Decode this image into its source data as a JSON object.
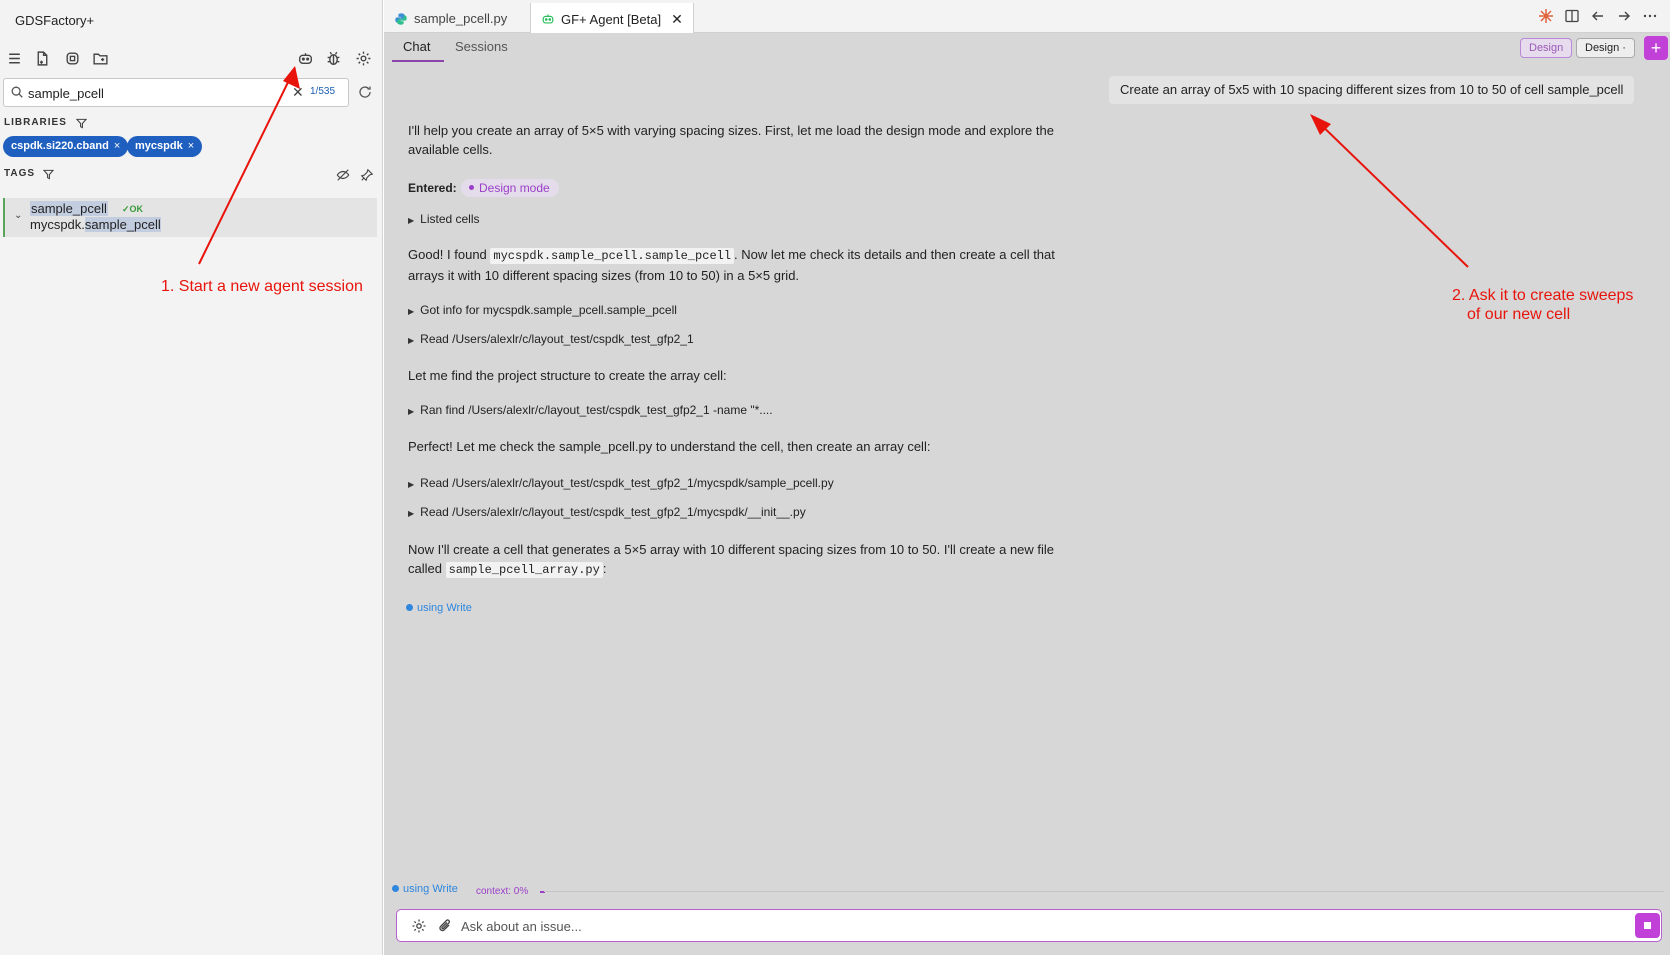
{
  "sidebar": {
    "app_title": "GDSFactory+",
    "search": {
      "value": "sample_pcell",
      "count": "1/535"
    },
    "libraries_label": "LIBRARIES",
    "libraries": [
      {
        "label": "cspdk.si220.cband",
        "remove": "×"
      },
      {
        "label": "mycspdk",
        "remove": "×"
      }
    ],
    "tags_label": "TAGS",
    "tree": {
      "chevron": "⌄",
      "name": "sample_pcell",
      "status": "✓OK",
      "path_prefix": "mycspdk.",
      "path_highlight": "sample_pcell"
    }
  },
  "tabs": [
    {
      "label": "sample_pcell.py",
      "icon": "python-icon",
      "active": false
    },
    {
      "label": "GF+ Agent [Beta]",
      "icon": "agent-icon",
      "active": true,
      "close": "✕"
    }
  ],
  "chat": {
    "tabs": [
      "Chat",
      "Sessions"
    ],
    "mode_badge": "Design",
    "mode_select": "Design ·",
    "plus": "+",
    "user_message": "Create an array of 5x5 with 10 spacing different sizes from 10 to 50 of cell sample_pcell",
    "assistant": {
      "msg1": "I'll help you create an array of 5×5 with varying spacing sizes. First, let me load the design mode and explore the available cells.",
      "entered_label": "Entered:",
      "entered_mode": "Design mode",
      "tool1": "Listed cells",
      "msg2_a": "Good! I found ",
      "msg2_code": "mycspdk.sample_pcell.sample_pcell",
      "msg2_b": ". Now let me check its details and then create a cell that arrays it with 10 different spacing sizes (from 10 to 50) in a 5×5 grid.",
      "tool2": "Got info for mycspdk.sample_pcell.sample_pcell",
      "tool3": "Read /Users/alexlr/c/layout_test/cspdk_test_gfp2_1",
      "msg3": "Let me find the project structure to create the array cell:",
      "tool4": "Ran find /Users/alexlr/c/layout_test/cspdk_test_gfp2_1 -name \"*....",
      "msg4": "Perfect! Let me check the sample_pcell.py to understand the cell, then create an array cell:",
      "tool5": "Read /Users/alexlr/c/layout_test/cspdk_test_gfp2_1/mycspdk/sample_pcell.py",
      "tool6": "Read /Users/alexlr/c/layout_test/cspdk_test_gfp2_1/mycspdk/__init__.py",
      "msg5_a": "Now I'll create a cell that generates a 5×5 array with 10 different spacing sizes from 10 to 50. I'll create a new file called ",
      "msg5_code": "sample_pcell_array.py",
      "msg5_b": ":",
      "using": "using Write"
    },
    "status": {
      "using": "using Write",
      "context": "context: 0%"
    },
    "input": {
      "placeholder": "Ask about an issue..."
    }
  },
  "annotations": {
    "label1": "1. Start a new agent session",
    "label2_line1": "2. Ask it to create sweeps",
    "label2_line2": "of our new cell",
    "color": "#e8140c"
  }
}
